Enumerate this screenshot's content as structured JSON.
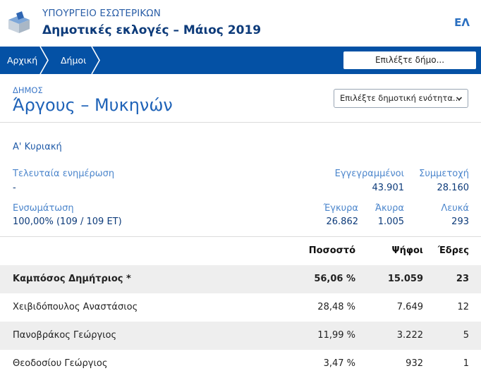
{
  "header": {
    "ministry": "ΥΠΟΥΡΓΕΙΟ ΕΣΩΤΕΡΙΚΩΝ",
    "election": "Δημοτικές εκλογές – Μάιος 2019",
    "language": "ΕΛ"
  },
  "nav": {
    "home": "Αρχική",
    "municipalities": "Δήμοι",
    "select_municipality": "Επιλέξτε δήμο..."
  },
  "municipality": {
    "label": "ΔΗΜΟΣ",
    "name": "Άργους – Μυκηνών",
    "unit_select_placeholder": "Επιλέξτε δημοτική ενότητα..."
  },
  "round": "Α' Κυριακή",
  "stats": {
    "last_update_label": "Τελευταία ενημέρωση",
    "last_update_value": "-",
    "registered_label": "Εγγεγραμμένοι",
    "registered_value": "43.901",
    "turnout_label": "Συμμετοχή",
    "turnout_value": "28.160",
    "integration_label": "Ενσωμάτωση",
    "integration_value": "100,00% (109 / 109 ΕΤ)",
    "valid_label": "Έγκυρα",
    "valid_value": "26.862",
    "invalid_label": "Άκυρα",
    "invalid_value": "1.005",
    "blank_label": "Λευκά",
    "blank_value": "293"
  },
  "table": {
    "headers": {
      "percent": "Ποσοστό",
      "votes": "Ψήφοι",
      "seats": "Έδρες"
    },
    "rows": [
      {
        "name": "Καμπόσος Δημήτριος *",
        "percent": "56,06 %",
        "votes": "15.059",
        "seats": "23"
      },
      {
        "name": "Χειβιδόπουλος Αναστάσιος",
        "percent": "28,48 %",
        "votes": "7.649",
        "seats": "12"
      },
      {
        "name": "Πανοβράκος Γεώργιος",
        "percent": "11,99 %",
        "votes": "3.222",
        "seats": "5"
      },
      {
        "name": "Θεοδοσίου Γεώργιος",
        "percent": "3,47 %",
        "votes": "932",
        "seats": "1"
      }
    ]
  },
  "colors": {
    "nav_bar": "#0451a5",
    "title_blue": "#1f63b8",
    "row_highlight": "#eeeeee"
  },
  "icons": {
    "logo": "ballot-box-icon",
    "breadcrumb_separator": "chevron-right-icon",
    "dropdown": "chevron-down-icon"
  }
}
